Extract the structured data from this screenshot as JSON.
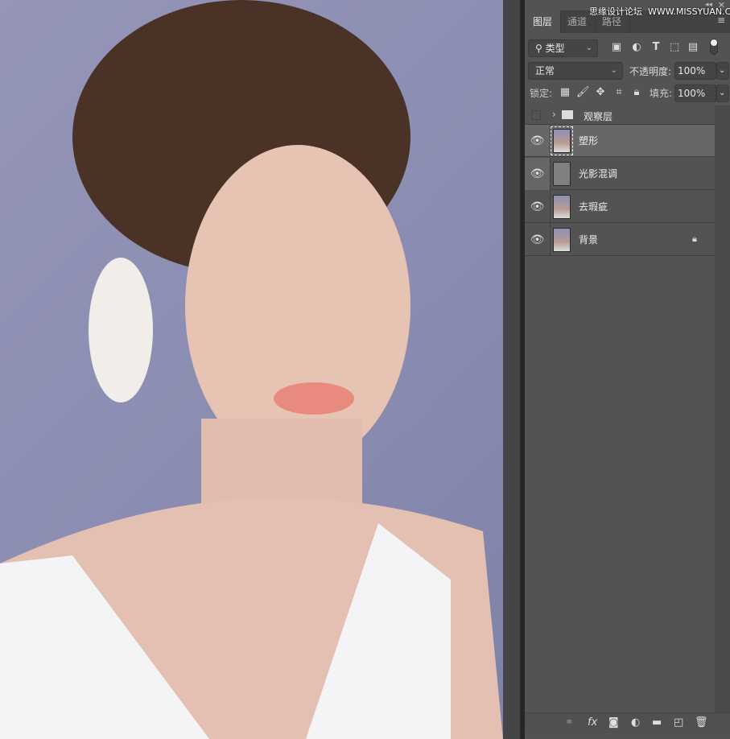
{
  "panel": {
    "tabs": [
      {
        "label": "图层",
        "active": true
      },
      {
        "label": "通道",
        "active": false
      },
      {
        "label": "路径",
        "active": false
      }
    ],
    "watermark": "思缘设计论坛  WWW.MISSYUAN.COM",
    "filter": {
      "label": "类型",
      "icon": "search-icon"
    },
    "blend_mode": "正常",
    "opacity_label": "不透明度:",
    "opacity_value": "100%",
    "lock_label": "锁定:",
    "fill_label": "填充:",
    "fill_value": "100%",
    "group": {
      "name": "观察层",
      "visible": false,
      "expanded": false
    },
    "layers": [
      {
        "name": "塑形",
        "visible": true,
        "selected": true,
        "locked": false
      },
      {
        "name": "光影混调",
        "visible": true,
        "selected": false,
        "locked": false
      },
      {
        "name": "去瑕疵",
        "visible": true,
        "selected": false,
        "locked": false
      },
      {
        "name": "背景",
        "visible": true,
        "selected": false,
        "locked": true
      }
    ]
  },
  "colors": {
    "panel_bg": "#535353",
    "selected_row": "#676767",
    "canvas_bg": "#8b8db2"
  }
}
